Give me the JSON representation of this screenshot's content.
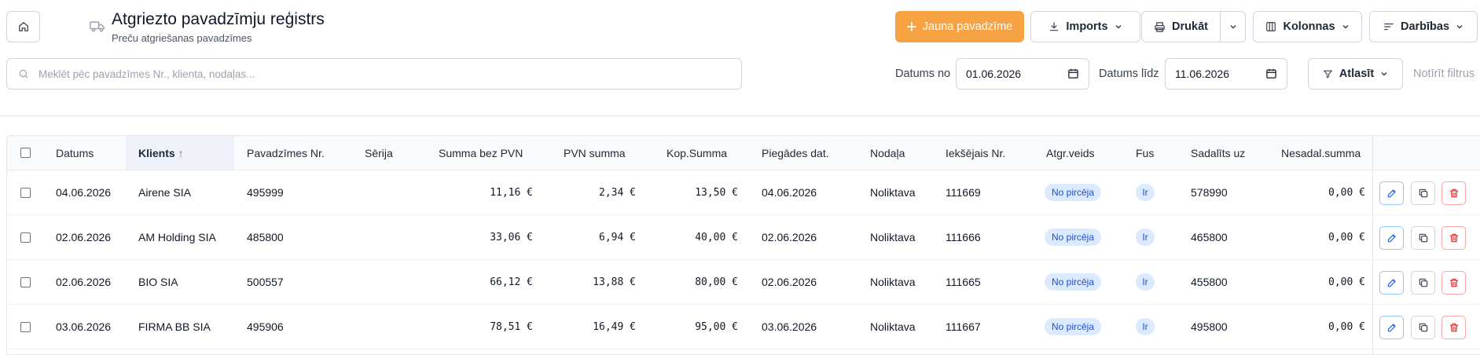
{
  "header": {
    "title": "Atgriezto pavadzīmju reģistrs",
    "subtitle": "Preču atgriešanas pavadzīmes"
  },
  "toolbar": {
    "new_label": "Jauna pavadzīme",
    "import_label": "Imports",
    "print_label": "Drukāt",
    "columns_label": "Kolonnas",
    "actions_label": "Darbības"
  },
  "search": {
    "placeholder": "Meklēt pēc pavadzīmes Nr., klienta, nodaļas...",
    "value": ""
  },
  "filters": {
    "date_from_label": "Datums no",
    "date_from": "01.06.2026",
    "date_to_label": "Datums līdz",
    "date_to": "11.06.2026",
    "filter_label": "Atlasīt",
    "clear_label": "Notīrīt filtrus"
  },
  "table": {
    "headers": {
      "date": "Datums",
      "client": "Klients",
      "sort_arrow": "↑",
      "invoice_no": "Pavadzīmes Nr.",
      "series": "Sērija",
      "sum_net": "Summa bez PVN",
      "vat": "PVN summa",
      "total": "Kop.Summa",
      "delivery_date": "Piegādes dat.",
      "department": "Nodaļa",
      "internal_no": "Iekšējais Nr.",
      "return_type": "Atgr.veids",
      "fus": "Fus",
      "split_to": "Sadalīts uz",
      "undistributed": "Nesadal.summa"
    },
    "rows": [
      {
        "date": "04.06.2026",
        "client": "Airene SIA",
        "invoice_no": "495999",
        "series": "",
        "sum_net": "11,16 €",
        "vat": "2,34 €",
        "total": "13,50 €",
        "delivery_date": "04.06.2026",
        "department": "Noliktava",
        "internal_no": "111669",
        "return_type": "No pircēja",
        "fus": "Ir",
        "split_to": "578990",
        "undistributed": "0,00 €"
      },
      {
        "date": "02.06.2026",
        "client": "AM Holding SIA",
        "invoice_no": "485800",
        "series": "",
        "sum_net": "33,06 €",
        "vat": "6,94 €",
        "total": "40,00 €",
        "delivery_date": "02.06.2026",
        "department": "Noliktava",
        "internal_no": "111666",
        "return_type": "No pircēja",
        "fus": "Ir",
        "split_to": "465800",
        "undistributed": "0,00 €"
      },
      {
        "date": "02.06.2026",
        "client": "BIO SIA",
        "invoice_no": "500557",
        "series": "",
        "sum_net": "66,12 €",
        "vat": "13,88 €",
        "total": "80,00 €",
        "delivery_date": "02.06.2026",
        "department": "Noliktava",
        "internal_no": "111665",
        "return_type": "No pircēja",
        "fus": "Ir",
        "split_to": "455800",
        "undistributed": "0,00 €"
      },
      {
        "date": "03.06.2026",
        "client": "FIRMA BB SIA",
        "invoice_no": "495906",
        "series": "",
        "sum_net": "78,51 €",
        "vat": "16,49 €",
        "total": "95,00 €",
        "delivery_date": "03.06.2026",
        "department": "Noliktava",
        "internal_no": "111667",
        "return_type": "No pircēja",
        "fus": "Ir",
        "split_to": "495800",
        "undistributed": "0,00 €"
      }
    ]
  },
  "colors": {
    "accent": "#f7a343",
    "badge_bg": "#dbeafe",
    "badge_text": "#1d4ed8",
    "edit": "#2563eb",
    "delete": "#dc2626"
  },
  "icons": {
    "home": "home-icon",
    "truck": "truck-icon",
    "plus": "plus-icon",
    "download": "download-icon",
    "printer": "printer-icon",
    "columns": "columns-icon",
    "actions": "list-filter-icon",
    "search": "search-icon",
    "calendar": "calendar-icon",
    "filter": "filter-icon",
    "edit": "pencil-icon",
    "copy": "copy-icon",
    "delete": "trash-icon"
  }
}
